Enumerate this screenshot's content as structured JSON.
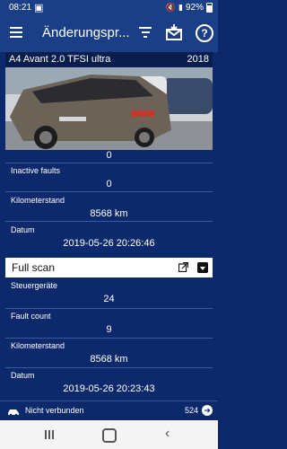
{
  "status_bar": {
    "time": "08:21",
    "battery": "92%"
  },
  "app_bar": {
    "title": "Änderungspr...",
    "icons": [
      "menu-icon",
      "filter-icon",
      "mail-icon",
      "help-icon"
    ]
  },
  "vehicle": {
    "model": "A4 Avant 2.0 TFSI ultra",
    "year": "2018"
  },
  "summary": {
    "top_value": "0",
    "inactive_faults_label": "Inactive faults",
    "inactive_faults_value": "0",
    "km_label": "Kilometerstand",
    "km_value": "8568 km",
    "date_label": "Datum",
    "date_value": "2019-05-26 20:26:46"
  },
  "full_scan": {
    "title": "Full scan",
    "controllers_label": "Steuergeräte",
    "controllers_value": "24",
    "fault_count_label": "Fault count",
    "fault_count_value": "9",
    "km_label": "Kilometerstand",
    "km_value": "8568 km",
    "date_label": "Datum",
    "date_value": "2019-05-26 20:23:43"
  },
  "bottom_status": {
    "connection": "Nicht verbunden",
    "count": "524"
  },
  "colors": {
    "background": "#0c2a6b",
    "appbar": "#1b3f86"
  }
}
